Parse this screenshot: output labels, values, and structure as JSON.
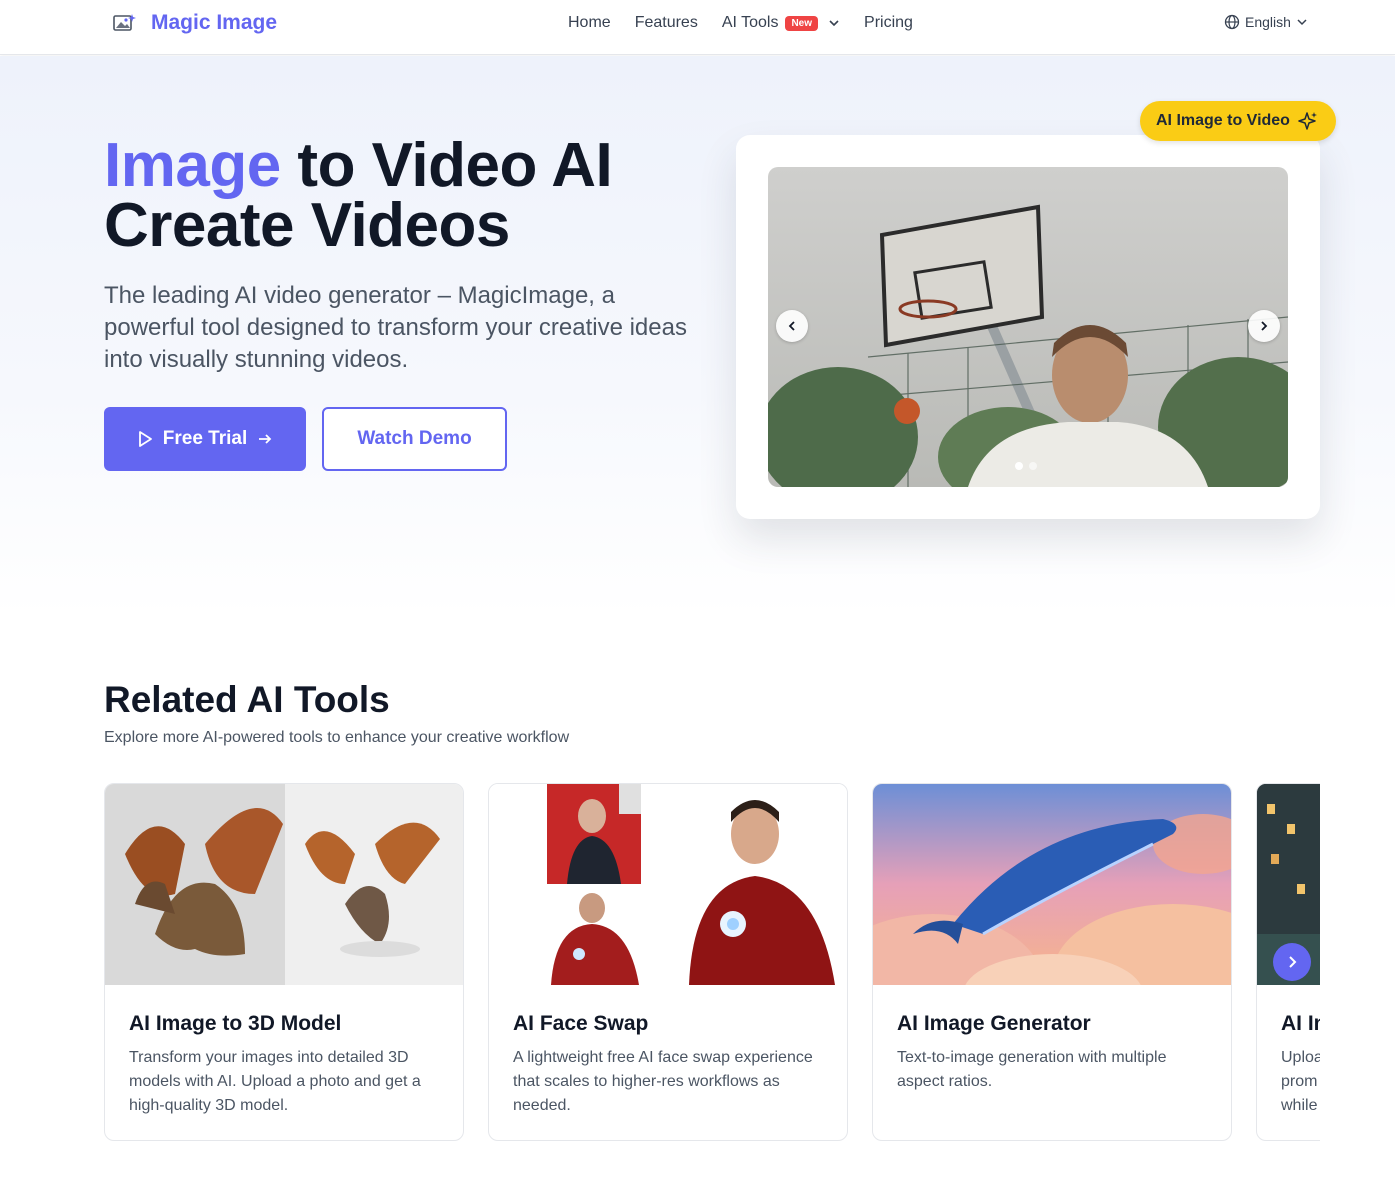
{
  "nav": {
    "brand": "Magic Image",
    "links": [
      "Home",
      "Features"
    ],
    "ai_tools": "AI Tools",
    "new_badge": "New",
    "pricing": "Pricing",
    "language": "English"
  },
  "hero": {
    "title_accent": "Image",
    "title_rest": " to Video AI",
    "title_line2": "Create Videos",
    "description": "The leading AI video generator – MagicImage, a powerful tool designed to transform your creative ideas into visually stunning videos.",
    "free_trial": "Free Trial",
    "watch_demo": "Watch Demo",
    "pill": "AI Image to Video",
    "carousel": {
      "slides": 2,
      "active": 1
    }
  },
  "related": {
    "title": "Related AI Tools",
    "subtitle": "Explore more AI-powered tools to enhance your creative workflow",
    "tools": [
      {
        "name": "AI Image to 3D Model",
        "desc": "Transform your images into detailed 3D models with AI. Upload a photo and get a high-quality 3D model."
      },
      {
        "name": "AI Face Swap",
        "desc": "A lightweight free AI face swap experience that scales to higher-res workflows as needed."
      },
      {
        "name": "AI Image Generator",
        "desc": "Text-to-image generation with multiple aspect ratios."
      },
      {
        "name": "AI Im",
        "desc": "Uploa prom while"
      }
    ]
  },
  "colors": {
    "accent": "#6366f1",
    "pill": "#facc15",
    "badge": "#ef4444"
  }
}
